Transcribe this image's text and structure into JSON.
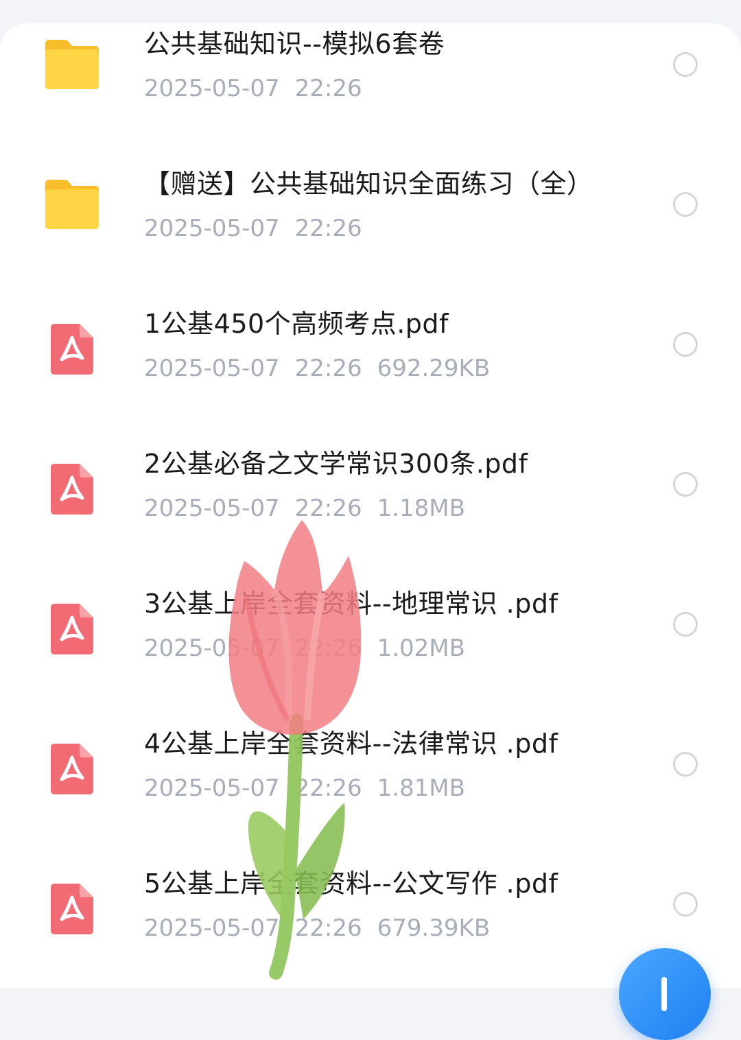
{
  "files": [
    {
      "type": "folder",
      "icon": "folder-icon",
      "name": "公共基础知识--模拟6套卷",
      "date": "2025-05-07",
      "time": "22:26",
      "size": ""
    },
    {
      "type": "folder",
      "icon": "folder-icon",
      "name": "【赠送】公共基础知识全面练习（全）",
      "date": "2025-05-07",
      "time": "22:26",
      "size": ""
    },
    {
      "type": "pdf",
      "icon": "pdf-icon",
      "name": "1公基450个高频考点.pdf",
      "date": "2025-05-07",
      "time": "22:26",
      "size": "692.29KB"
    },
    {
      "type": "pdf",
      "icon": "pdf-icon",
      "name": "2公基必备之文学常识300条.pdf",
      "date": "2025-05-07",
      "time": "22:26",
      "size": "1.18MB"
    },
    {
      "type": "pdf",
      "icon": "pdf-icon",
      "name": "3公基上岸全套资料--地理常识 .pdf",
      "date": "2025-05-07",
      "time": "22:26",
      "size": "1.02MB"
    },
    {
      "type": "pdf",
      "icon": "pdf-icon",
      "name": "4公基上岸全套资料--法律常识 .pdf",
      "date": "2025-05-07",
      "time": "22:26",
      "size": "1.81MB"
    },
    {
      "type": "pdf",
      "icon": "pdf-icon",
      "name": "5公基上岸全套资料--公文写作 .pdf",
      "date": "2025-05-07",
      "time": "22:26",
      "size": "679.39KB"
    }
  ],
  "fab": {
    "icon": "plus-icon"
  },
  "overlay": {
    "icon": "tulip-drawing-icon"
  },
  "colors": {
    "folder": "#ffcf3f",
    "pdf": "#f06a72",
    "meta_text": "#a9adb8",
    "name_text": "#1a1a1a",
    "fab": "#2a8cf6"
  }
}
